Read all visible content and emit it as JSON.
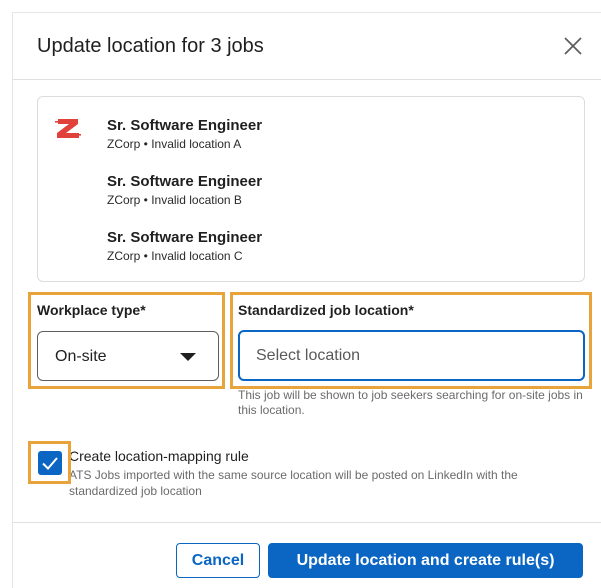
{
  "dialog": {
    "title": "Update location for 3 jobs",
    "close_icon": "close-icon"
  },
  "jobs": [
    {
      "title": "Sr. Software Engineer",
      "subtitle": "ZCorp • Invalid location A"
    },
    {
      "title": "Sr. Software Engineer",
      "subtitle": "ZCorp • Invalid location B"
    },
    {
      "title": "Sr. Software Engineer",
      "subtitle": "ZCorp • Invalid location C"
    }
  ],
  "company_logo": {
    "icon": "zcorp-logo",
    "color": "#e0413a"
  },
  "workplace_type": {
    "label": "Workplace type*",
    "value": "On-site"
  },
  "job_location": {
    "label": "Standardized job location*",
    "placeholder": "Select location",
    "value": "",
    "helper": "This job will be shown to job seekers searching for on-site jobs in this location."
  },
  "mapping_rule": {
    "checked": true,
    "label": "Create location-mapping rule",
    "description": "ATS Jobs imported with the same source location will be posted on LinkedIn with the standardized job location"
  },
  "footer": {
    "cancel_label": "Cancel",
    "primary_label": "Update location and create rule(s)"
  },
  "colors": {
    "accent": "#0a66c2",
    "highlight": "#e8a33b"
  }
}
